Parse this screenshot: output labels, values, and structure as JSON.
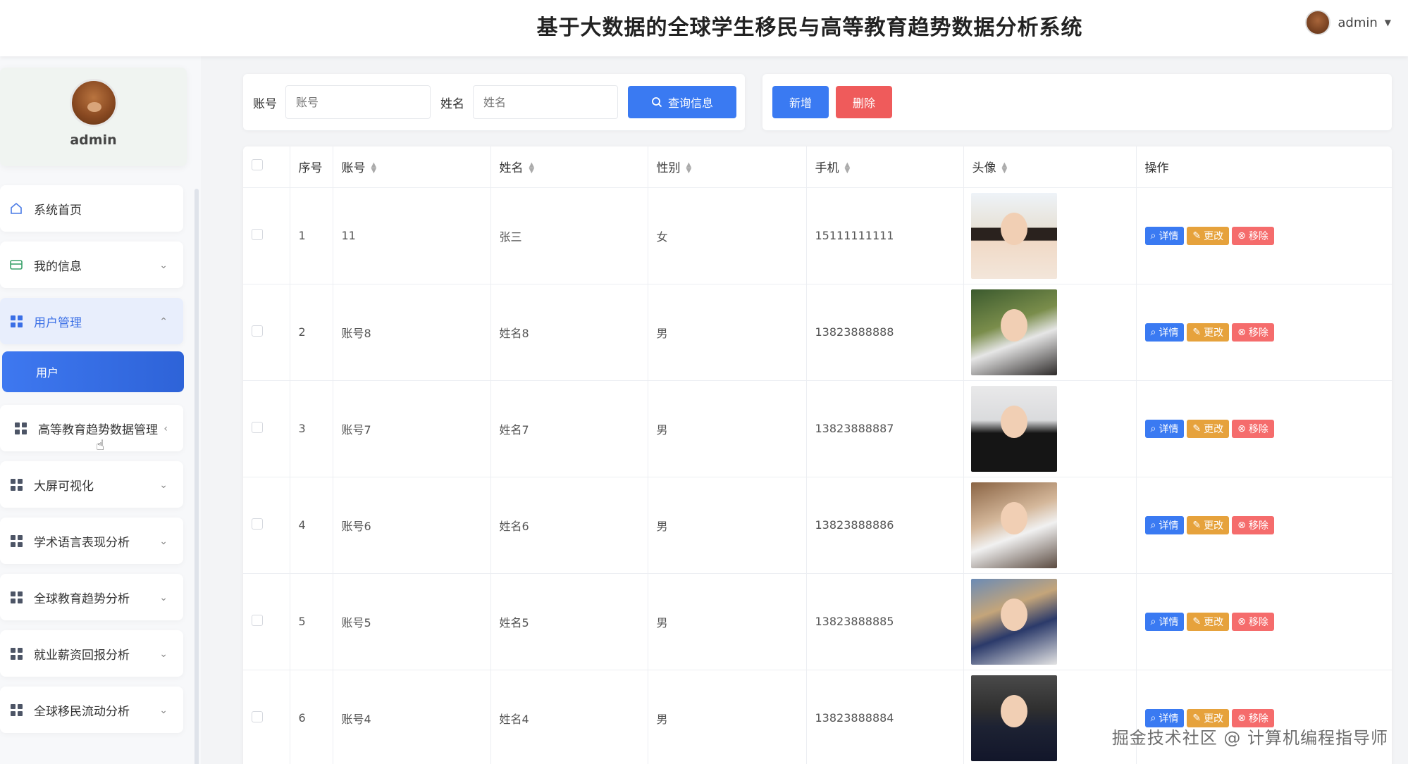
{
  "header": {
    "title": "基于大数据的全球学生移民与高等教育趋势数据分析系统",
    "username": "admin"
  },
  "sidebar": {
    "profile_name": "admin",
    "items": [
      {
        "label": "系统首页",
        "icon": "home-icon"
      },
      {
        "label": "我的信息",
        "icon": "card-icon"
      },
      {
        "label": "用户管理",
        "icon": "grid-icon"
      },
      {
        "label": "高等教育趋势数据管理",
        "icon": "grid-icon"
      },
      {
        "label": "大屏可视化",
        "icon": "grid-icon"
      },
      {
        "label": "学术语言表现分析",
        "icon": "grid-icon"
      },
      {
        "label": "全球教育趋势分析",
        "icon": "grid-icon"
      },
      {
        "label": "就业薪资回报分析",
        "icon": "grid-icon"
      },
      {
        "label": "全球移民流动分析",
        "icon": "grid-icon"
      }
    ],
    "submenu_label": "用户"
  },
  "search": {
    "account_label": "账号",
    "account_placeholder": "账号",
    "name_label": "姓名",
    "name_placeholder": "姓名",
    "query_button": "查询信息"
  },
  "actions": {
    "add_button": "新增",
    "delete_button": "删除"
  },
  "table": {
    "headers": [
      "序号",
      "账号",
      "姓名",
      "性别",
      "手机",
      "头像",
      "操作"
    ],
    "rows": [
      {
        "index": "1",
        "account": "11",
        "name": "张三",
        "gender": "女",
        "phone": "15111111111"
      },
      {
        "index": "2",
        "account": "账号8",
        "name": "姓名8",
        "gender": "男",
        "phone": "13823888888"
      },
      {
        "index": "3",
        "account": "账号7",
        "name": "姓名7",
        "gender": "男",
        "phone": "13823888887"
      },
      {
        "index": "4",
        "account": "账号6",
        "name": "姓名6",
        "gender": "男",
        "phone": "13823888886"
      },
      {
        "index": "5",
        "account": "账号5",
        "name": "姓名5",
        "gender": "男",
        "phone": "13823888885"
      },
      {
        "index": "6",
        "account": "账号4",
        "name": "姓名4",
        "gender": "男",
        "phone": "13823888884"
      }
    ],
    "op_detail": "详情",
    "op_edit": "更改",
    "op_remove": "移除"
  },
  "watermark": "掘金技术社区 @ 计算机编程指导师",
  "colors": {
    "primary": "#3a7af2",
    "danger": "#ef5b5b",
    "warning": "#e6a23c",
    "remove": "#f56c6c"
  }
}
